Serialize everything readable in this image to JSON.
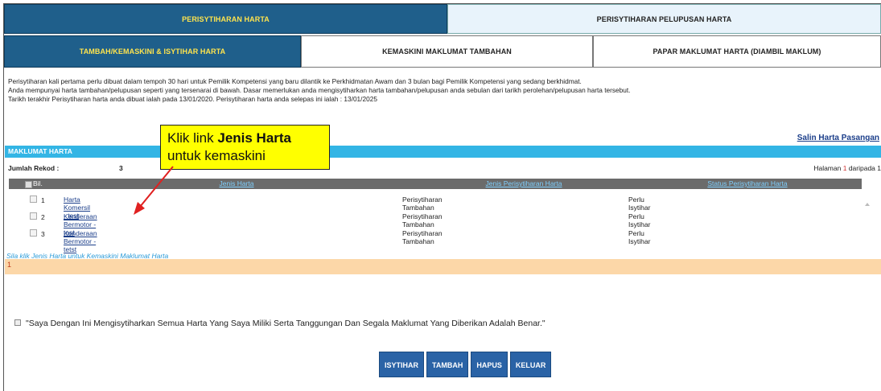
{
  "tabs_top": [
    "PERISYTIHARAN HARTA",
    "PERISYTIHARAN PELUPUSAN HARTA"
  ],
  "tabs_sub": [
    "TAMBAH/KEMASKINI & ISYTIHAR HARTA",
    "KEMASKINI MAKLUMAT TAMBAHAN",
    "PAPAR MAKLUMAT HARTA (DIAMBIL MAKLUM)"
  ],
  "info": [
    "Perisytiharan kali pertama perlu dibuat dalam tempoh 30 hari untuk Pemilik Kompetensi yang baru dilantik ke Perkhidmatan Awam dan 3 bulan bagi Pemilik Kompetensi yang sedang berkhidmat.",
    "Anda mempunyai harta tambahan/pelupusan seperti yang tersenarai di bawah. Dasar memerlukan anda mengisytiharkan harta tambahan/pelupusan anda sebulan dari tarikh perolehan/pelupusan harta tersebut.",
    "Tarikh terakhir Perisytiharan harta anda dibuat ialah pada 13/01/2020. Perisytiharan harta anda selepas ini ialah : 13/01/2025"
  ],
  "salin_link": "Salin Harta Pasangan",
  "section_title": "MAKLUMAT HARTA",
  "record_label": "Jumlah Rekod :",
  "record_count": "3",
  "page_text_prefix": "Halaman ",
  "page_current": "1",
  "page_text_suffix": " daripada 1",
  "columns": [
    "Bil.",
    "Jenis Harta",
    "Jenis Perisytiharan Harta",
    "Status Perisytiharan Harta"
  ],
  "rows": [
    {
      "no": "1",
      "jenis": "Harta Komersil - test",
      "jp": "Perisytiharan Tambahan",
      "status": "Perlu Isytihar"
    },
    {
      "no": "2",
      "jenis": "Kenderaan Bermotor - test",
      "jp": "Perisytiharan Tambahan",
      "status": "Perlu Isytihar"
    },
    {
      "no": "3",
      "jenis": "Kenderaan Bermotor - tetst",
      "jp": "Perisytiharan Tambahan",
      "status": "Perlu Isytihar"
    }
  ],
  "hint": "Sila klik Jenis Harta untuk Kemaskini Maklumat Harta",
  "pager_value": "1",
  "declaration": "\"Saya Dengan Ini Mengisytiharkan Semua Harta Yang Saya Miliki Serta Tanggungan Dan Segala Maklumat Yang Diberikan Adalah Benar.\"",
  "buttons": [
    "ISYTIHAR",
    "TAMBAH",
    "HAPUS",
    "KELUAR"
  ],
  "callout": {
    "line1_prefix": "Klik link ",
    "line1_bold": "Jenis Harta",
    "line2": "untuk kemaskini"
  },
  "colors": {
    "tab_dark": "#1f5f8b",
    "tab_text_active": "#ffe44d",
    "section_bar": "#33b5e5",
    "pager_bar": "#fcd7a8",
    "button": "#2a63a6",
    "callout": "#ffff00",
    "arrow": "#e02020"
  }
}
